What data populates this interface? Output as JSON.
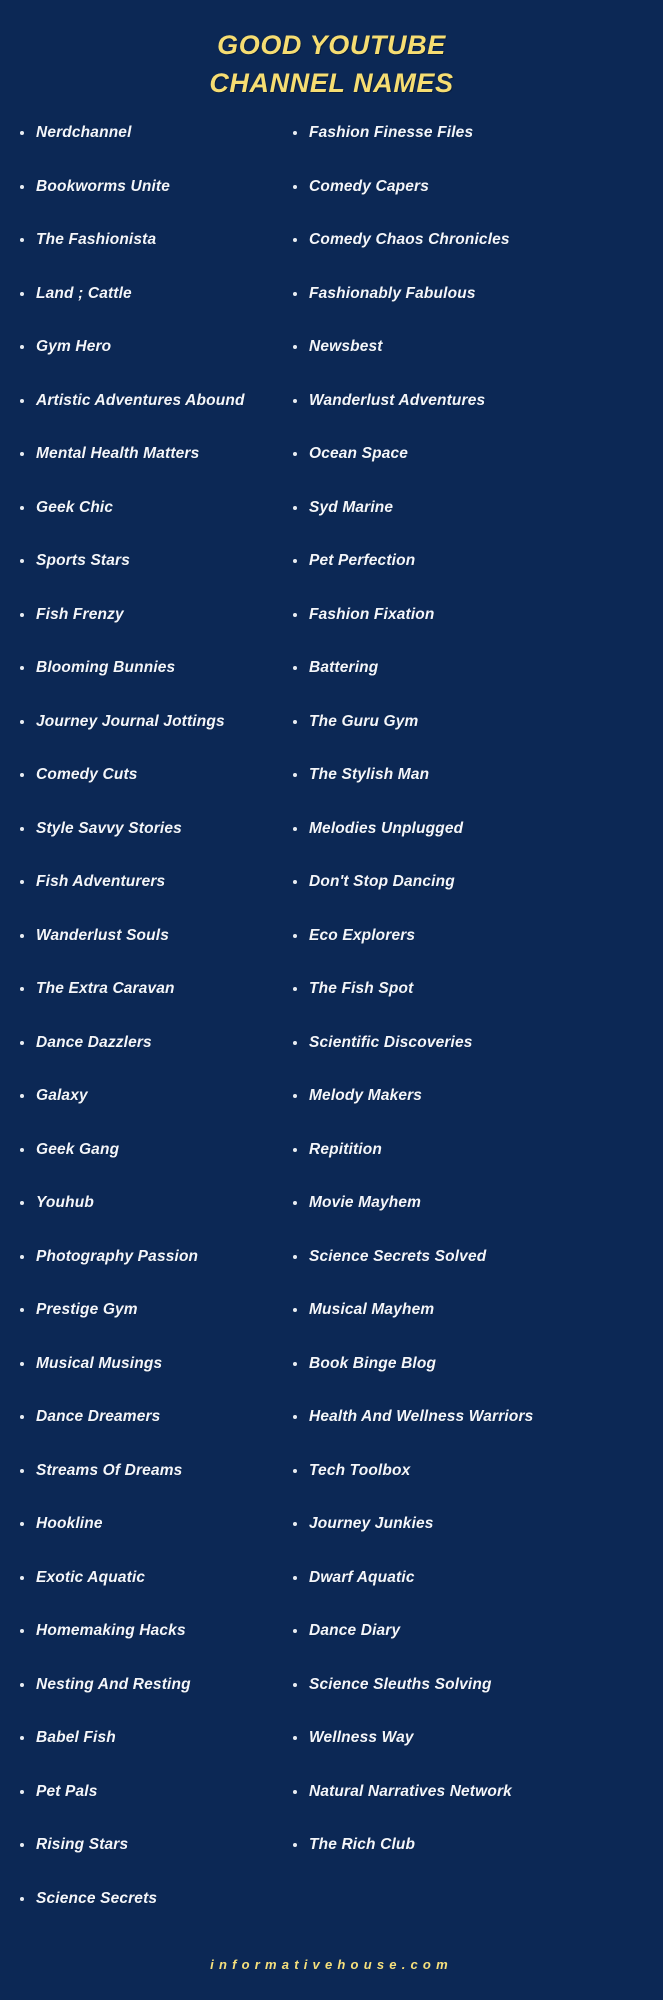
{
  "colors": {
    "background": "#0c2855",
    "title": "#f6dd72",
    "list_text": "#f4f6fa",
    "bullet": "#e8ecf2",
    "footer": "#f6e07c"
  },
  "header": {
    "title_lines": [
      "GOOD YOUTUBE",
      "CHANNEL NAMES"
    ],
    "title_full": "GOOD YOUTUBE CHANNEL NAMES"
  },
  "columns": {
    "left": [
      "Nerdchannel",
      "Bookworms Unite",
      "The Fashionista",
      "Land ; Cattle",
      "Gym Hero",
      "Artistic Adventures Abound",
      "Mental Health Matters",
      "Geek Chic",
      "Sports Stars",
      "Fish Frenzy",
      "Blooming Bunnies",
      "Journey Journal Jottings",
      "Comedy Cuts",
      "Style Savvy Stories",
      "Fish Adventurers",
      "Wanderlust Souls",
      "The Extra Caravan",
      "Dance Dazzlers",
      "Galaxy",
      "Geek Gang",
      "Youhub",
      "Photography Passion",
      "Prestige Gym",
      "Musical Musings",
      "Dance Dreamers",
      "Streams Of Dreams",
      "Hookline",
      "Exotic Aquatic",
      "Homemaking Hacks",
      "Nesting And Resting",
      "Babel Fish",
      "Pet Pals",
      "Rising Stars",
      "Science Secrets"
    ],
    "right": [
      "Fashion Finesse Files",
      "Comedy Capers",
      "Comedy Chaos Chronicles",
      "Fashionably Fabulous",
      "Newsbest",
      "Wanderlust Adventures",
      "Ocean Space",
      "Syd Marine",
      "Pet Perfection",
      "Fashion Fixation",
      "Battering",
      "The Guru Gym",
      "The Stylish Man",
      "Melodies Unplugged",
      "Don't Stop Dancing",
      "Eco Explorers",
      "The Fish Spot",
      "Scientific Discoveries",
      "Melody Makers",
      "Repitition",
      "Movie Mayhem",
      "Science Secrets Solved",
      "Musical Mayhem",
      "Book Binge Blog",
      "Health And Wellness Warriors",
      "Tech Toolbox",
      "Journey Junkies",
      "Dwarf Aquatic",
      "Dance Diary",
      "Science Sleuths Solving",
      "Wellness Way",
      "Natural Narratives Network",
      "The Rich Club"
    ]
  },
  "footer": {
    "site": "informativehouse.com"
  }
}
